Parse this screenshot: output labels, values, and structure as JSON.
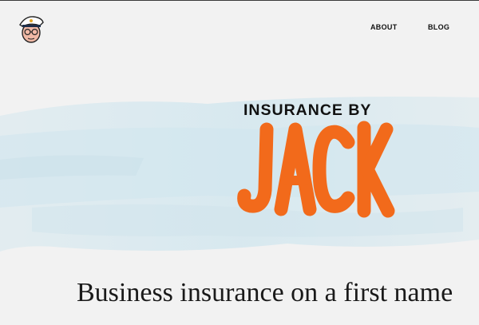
{
  "header": {
    "nav": [
      {
        "label": "ABOUT"
      },
      {
        "label": "BLOG"
      }
    ]
  },
  "hero": {
    "brand_line1": "INSURANCE BY",
    "brand_line2": "JACK",
    "headline": "Business insurance on a first name",
    "accent_color": "#f26a1b",
    "wash_color": "#d6e8ef"
  }
}
